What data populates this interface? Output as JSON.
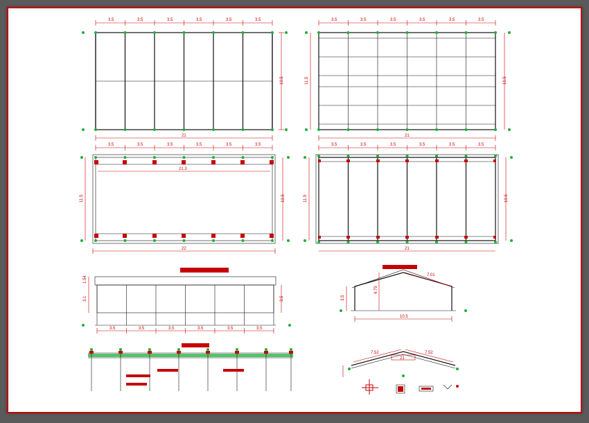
{
  "plan1": {
    "bay_spacing": [
      3.5,
      3.5,
      3.5,
      3.5,
      3.5,
      3.5
    ],
    "total_width": 21,
    "total_depth": 10.5
  },
  "plan2": {
    "bay_spacing": [
      3.5,
      3.5,
      3.5,
      3.5,
      3.5,
      3.5
    ],
    "total_width": 21,
    "total_depth": 10.5,
    "left_depth": 11.5
  },
  "plan3": {
    "bay_spacing": [
      3.5,
      3.5,
      3.5,
      3.5,
      3.5,
      3.5
    ],
    "inner_width": 21.3,
    "outer_width": 22,
    "depth": 11.5,
    "right_depth": 10.5
  },
  "plan4": {
    "bay_spacing": [
      3.5,
      3.5,
      3.5,
      3.5,
      3.5,
      3.5
    ],
    "total_width": 21,
    "left_depth": 11.5,
    "right_depth": 10.5
  },
  "elevation": {
    "bay_spacing": [
      3.5,
      3.5,
      3.5,
      3.5,
      3.5,
      3.5
    ],
    "eave": 3.1,
    "parapet": 1.54,
    "right_h": 3.5
  },
  "section": {
    "span": 10.5,
    "eave": 3.5,
    "ridge": 4.79,
    "roof_segment": 7.01
  },
  "roof": {
    "half_span": 7.52,
    "span": 21
  }
}
